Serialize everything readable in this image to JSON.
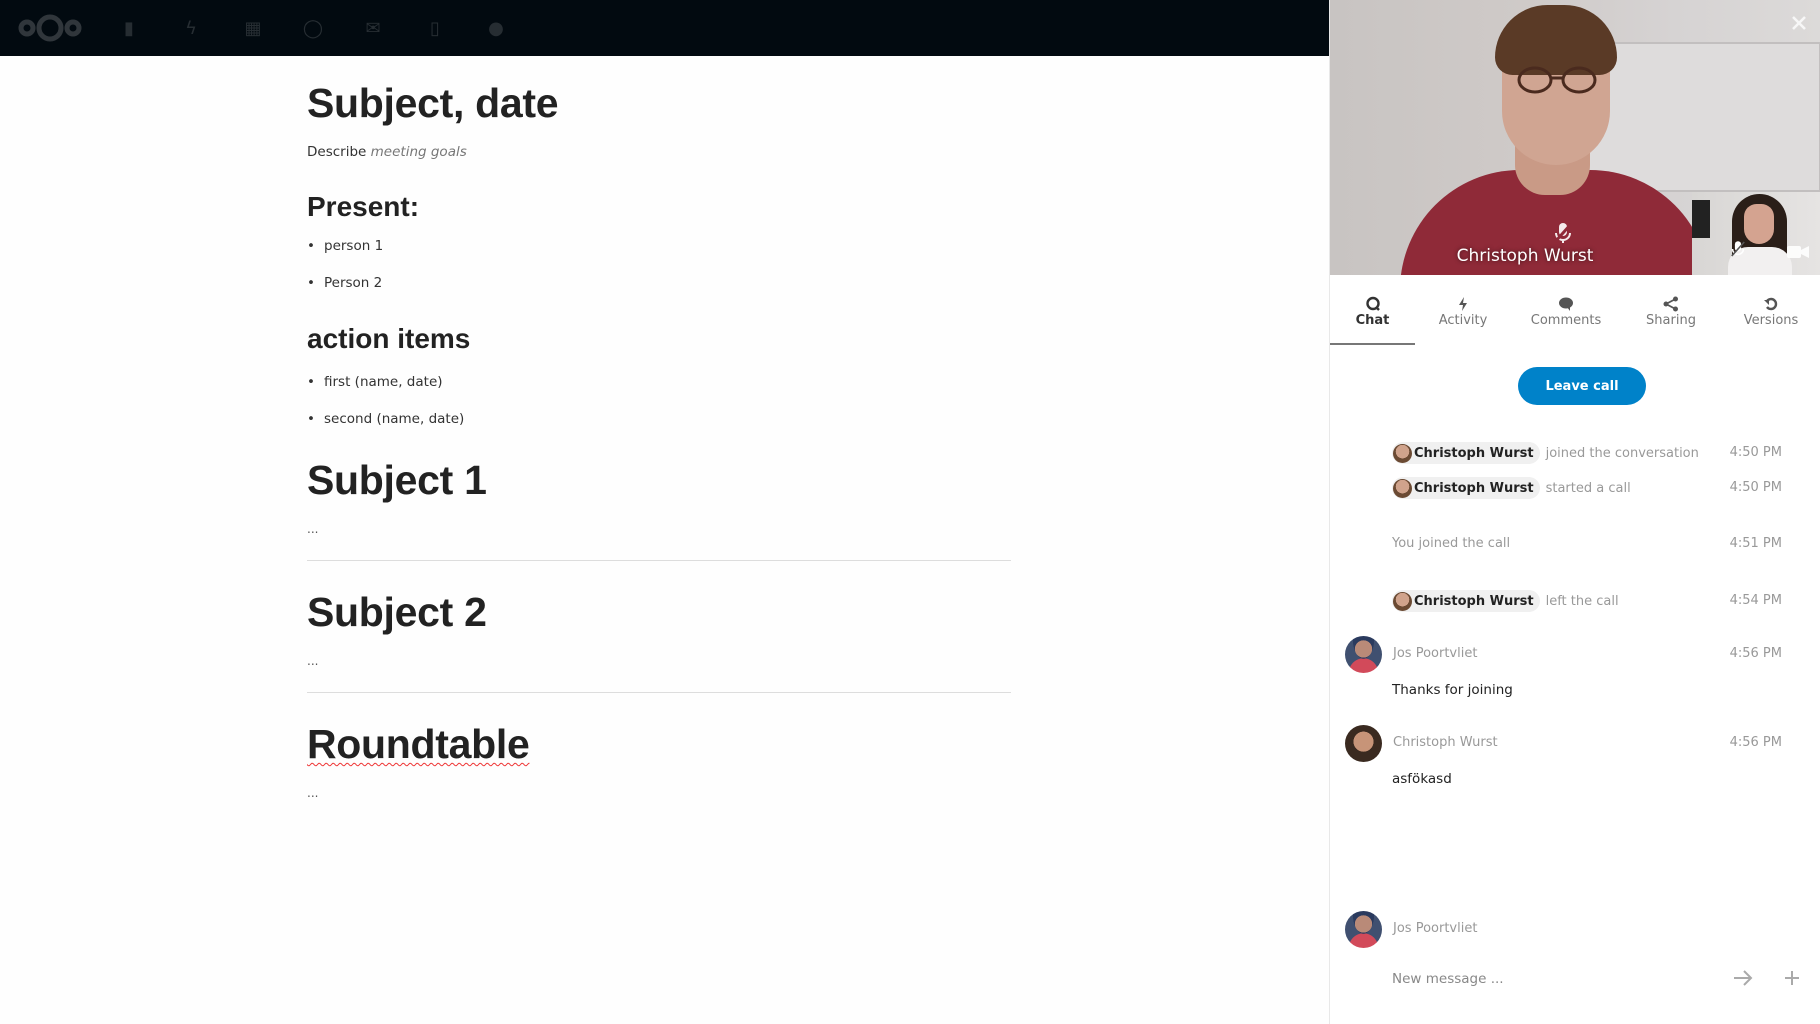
{
  "header": {
    "nav_icons": [
      "nextcloud-logo",
      "files-icon",
      "activity-icon",
      "photos-icon",
      "talk-icon",
      "mail-icon",
      "contacts-icon",
      "user-icon"
    ]
  },
  "document": {
    "title": "Subject, date",
    "intro_prefix": "Describe",
    "intro_italic": "meeting goals",
    "present_heading": "Present:",
    "present_items": [
      "person 1",
      "Person 2"
    ],
    "action_heading": "action items",
    "action_items": [
      "first (name, date)",
      "second (name, date)"
    ],
    "sections": [
      {
        "title": "Subject 1",
        "body": "..."
      },
      {
        "title": "Subject 2",
        "body": "..."
      },
      {
        "title": "Roundtable",
        "body": "..."
      }
    ]
  },
  "call": {
    "speaker_name": "Christoph Wurst",
    "close_label": "close"
  },
  "tabs": [
    {
      "label": "Chat",
      "icon": "chat-icon",
      "active": true
    },
    {
      "label": "Activity",
      "icon": "activity-icon",
      "active": false
    },
    {
      "label": "Comments",
      "icon": "comments-icon",
      "active": false
    },
    {
      "label": "Sharing",
      "icon": "share-icon",
      "active": false
    },
    {
      "label": "Versions",
      "icon": "history-icon",
      "active": false
    }
  ],
  "leave_call_label": "Leave call",
  "colors": {
    "primary": "#0082c9",
    "header_bg": "#020a10"
  },
  "chat": {
    "system_messages": [
      {
        "user": "Christoph Wurst",
        "action": "joined the conversation",
        "time": "4:50 PM"
      },
      {
        "user": "Christoph Wurst",
        "action": "started a call",
        "time": "4:50 PM"
      },
      {
        "user": "",
        "action": "You joined the call",
        "time": "4:51 PM"
      },
      {
        "user": "Christoph Wurst",
        "action": "left the call",
        "time": "4:54 PM"
      }
    ],
    "messages": [
      {
        "author": "Jos Poortvliet",
        "time": "4:56 PM",
        "text": "Thanks for joining"
      },
      {
        "author": "Christoph Wurst",
        "time": "4:56 PM",
        "text": "asfökasd"
      }
    ],
    "composer": {
      "author": "Jos Poortvliet",
      "placeholder": "New message ..."
    }
  }
}
